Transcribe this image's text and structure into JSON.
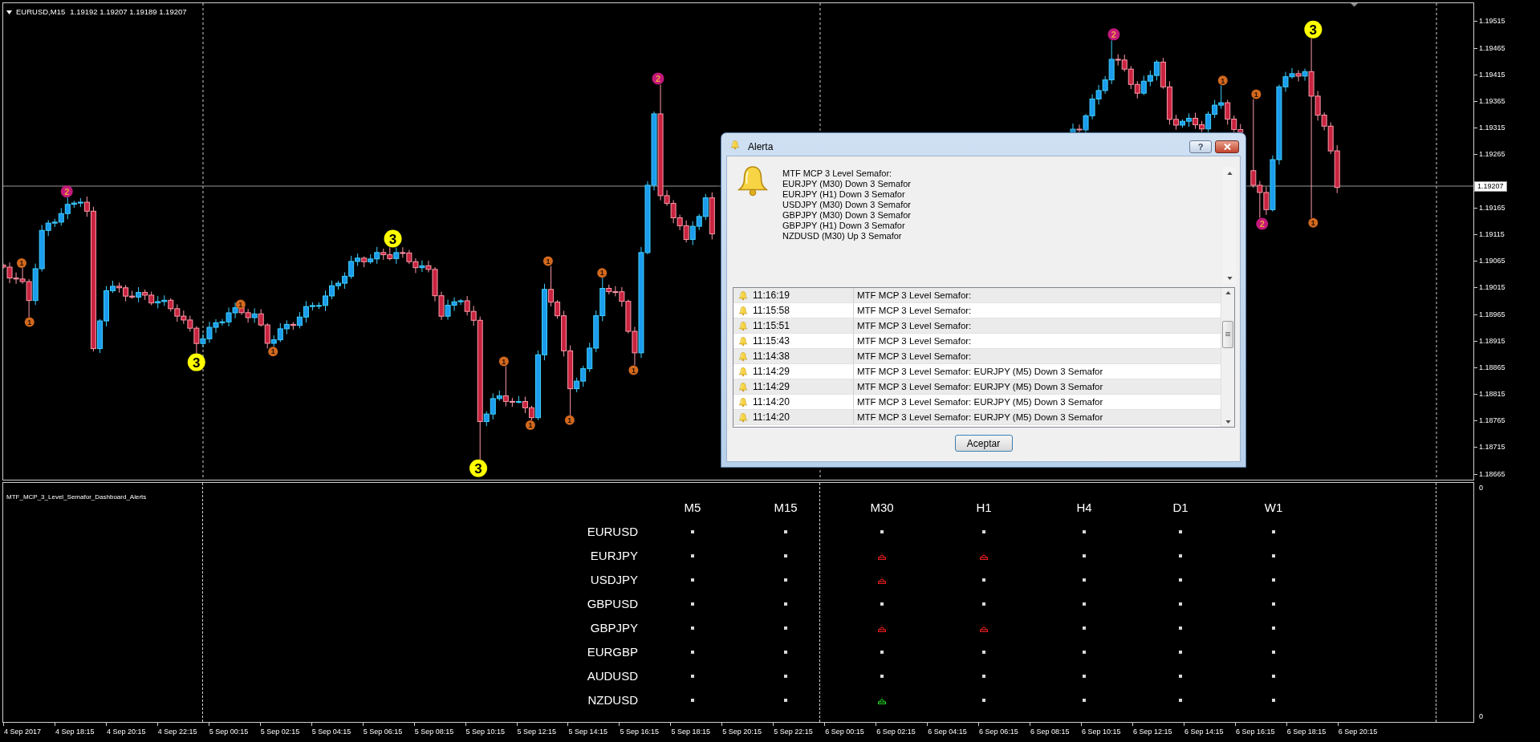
{
  "chart": {
    "symbol": "EURUSD,M15",
    "ohlc": "1.19192 1.19207 1.19189 1.19207",
    "level1_marks": [
      "1",
      "1",
      "1",
      "1",
      "1",
      "1",
      "1",
      "1",
      "1",
      "1",
      "1",
      "1",
      "1"
    ],
    "level2_marks": [
      "2",
      "2",
      "2",
      "2"
    ],
    "level3_marks": [
      "3",
      "3",
      "3",
      "3"
    ]
  },
  "price_axis": {
    "upper_labels": [
      "1.19515",
      "1.19465",
      "1.19415",
      "1.19365",
      "1.19315",
      "1.19265"
    ],
    "current_price": "1.19207",
    "lower_labels": [
      "1.19165",
      "1.19115",
      "1.19065",
      "1.19015",
      "1.18965",
      "1.18915",
      "1.18865",
      "1.18815",
      "1.18765",
      "1.18715",
      "1.18665"
    ]
  },
  "alert_dialog": {
    "title": "Alerta",
    "help_label": "?",
    "message_lines": [
      "MTF MCP 3 Level Semafor:",
      "EURJPY (M30) Down 3 Semafor",
      "EURJPY (H1) Down 3 Semafor",
      "USDJPY (M30) Down 3 Semafor",
      "GBPJPY (M30) Down 3 Semafor",
      "GBPJPY (H1) Down 3 Semafor",
      "NZDUSD (M30) Up 3 Semafor"
    ],
    "rows": [
      {
        "time": "11:16:19",
        "message": "MTF MCP 3 Level Semafor:"
      },
      {
        "time": "11:15:58",
        "message": "MTF MCP 3 Level Semafor:"
      },
      {
        "time": "11:15:51",
        "message": "MTF MCP 3 Level Semafor:"
      },
      {
        "time": "11:15:43",
        "message": "MTF MCP 3 Level Semafor:"
      },
      {
        "time": "11:14:38",
        "message": "MTF MCP 3 Level Semafor:"
      },
      {
        "time": "11:14:29",
        "message": "MTF MCP 3 Level Semafor: EURJPY (M5) Down 3 Semafor"
      },
      {
        "time": "11:14:29",
        "message": "MTF MCP 3 Level Semafor: EURJPY (M5) Down 3 Semafor"
      },
      {
        "time": "11:14:20",
        "message": "MTF MCP 3 Level Semafor: EURJPY (M5) Down 3 Semafor"
      },
      {
        "time": "11:14:20",
        "message": "MTF MCP 3 Level Semafor: EURJPY (M5) Down 3 Semafor"
      }
    ],
    "button": "Aceptar"
  },
  "dashboard": {
    "title": "MTF_MCP_3_Level_Semafor_Dashboard_Alerts",
    "columns": [
      "M5",
      "M15",
      "M30",
      "H1",
      "H4",
      "D1",
      "W1"
    ],
    "rows": [
      {
        "pair": "EURUSD",
        "cells": [
          {
            "kind": "dot"
          },
          {
            "kind": "dot"
          },
          {
            "kind": "dot"
          },
          {
            "kind": "dot"
          },
          {
            "kind": "dot"
          },
          {
            "kind": "dot"
          },
          {
            "kind": "dot"
          }
        ]
      },
      {
        "pair": "EURJPY",
        "cells": [
          {
            "kind": "dot"
          },
          {
            "kind": "dot"
          },
          {
            "kind": "down"
          },
          {
            "kind": "down"
          },
          {
            "kind": "dot"
          },
          {
            "kind": "dot"
          },
          {
            "kind": "dot"
          }
        ]
      },
      {
        "pair": "USDJPY",
        "cells": [
          {
            "kind": "dot"
          },
          {
            "kind": "dot"
          },
          {
            "kind": "down"
          },
          {
            "kind": "dot"
          },
          {
            "kind": "dot"
          },
          {
            "kind": "dot"
          },
          {
            "kind": "dot"
          }
        ]
      },
      {
        "pair": "GBPUSD",
        "cells": [
          {
            "kind": "dot"
          },
          {
            "kind": "dot"
          },
          {
            "kind": "dot"
          },
          {
            "kind": "dot"
          },
          {
            "kind": "dot"
          },
          {
            "kind": "dot"
          },
          {
            "kind": "dot"
          }
        ]
      },
      {
        "pair": "GBPJPY",
        "cells": [
          {
            "kind": "dot"
          },
          {
            "kind": "dot"
          },
          {
            "kind": "down"
          },
          {
            "kind": "down"
          },
          {
            "kind": "dot"
          },
          {
            "kind": "dot"
          },
          {
            "kind": "dot"
          }
        ]
      },
      {
        "pair": "EURGBP",
        "cells": [
          {
            "kind": "dot"
          },
          {
            "kind": "dot"
          },
          {
            "kind": "dot"
          },
          {
            "kind": "dot"
          },
          {
            "kind": "dot"
          },
          {
            "kind": "dot"
          },
          {
            "kind": "dot"
          }
        ]
      },
      {
        "pair": "AUDUSD",
        "cells": [
          {
            "kind": "dot"
          },
          {
            "kind": "dot"
          },
          {
            "kind": "dot"
          },
          {
            "kind": "dot"
          },
          {
            "kind": "dot"
          },
          {
            "kind": "dot"
          },
          {
            "kind": "dot"
          }
        ]
      },
      {
        "pair": "NZDUSD",
        "cells": [
          {
            "kind": "dot"
          },
          {
            "kind": "dot"
          },
          {
            "kind": "up"
          },
          {
            "kind": "dot"
          },
          {
            "kind": "dot"
          },
          {
            "kind": "dot"
          },
          {
            "kind": "dot"
          }
        ]
      }
    ]
  },
  "indicator_axis": {
    "labels": [
      "0",
      "0"
    ]
  },
  "time_axis": {
    "labels": [
      "4 Sep 2017",
      "4 Sep 18:15",
      "4 Sep 20:15",
      "4 Sep 22:15",
      "5 Sep 00:15",
      "5 Sep 02:15",
      "5 Sep 04:15",
      "5 Sep 06:15",
      "5 Sep 08:15",
      "5 Sep 10:15",
      "5 Sep 12:15",
      "5 Sep 14:15",
      "5 Sep 16:15",
      "5 Sep 18:15",
      "5 Sep 20:15",
      "5 Sep 22:15",
      "6 Sep 00:15",
      "6 Sep 02:15",
      "6 Sep 04:15",
      "6 Sep 06:15",
      "6 Sep 08:15",
      "6 Sep 10:15",
      "6 Sep 12:15",
      "6 Sep 14:15",
      "6 Sep 16:15",
      "6 Sep 18:15",
      "6 Sep 20:15"
    ]
  }
}
